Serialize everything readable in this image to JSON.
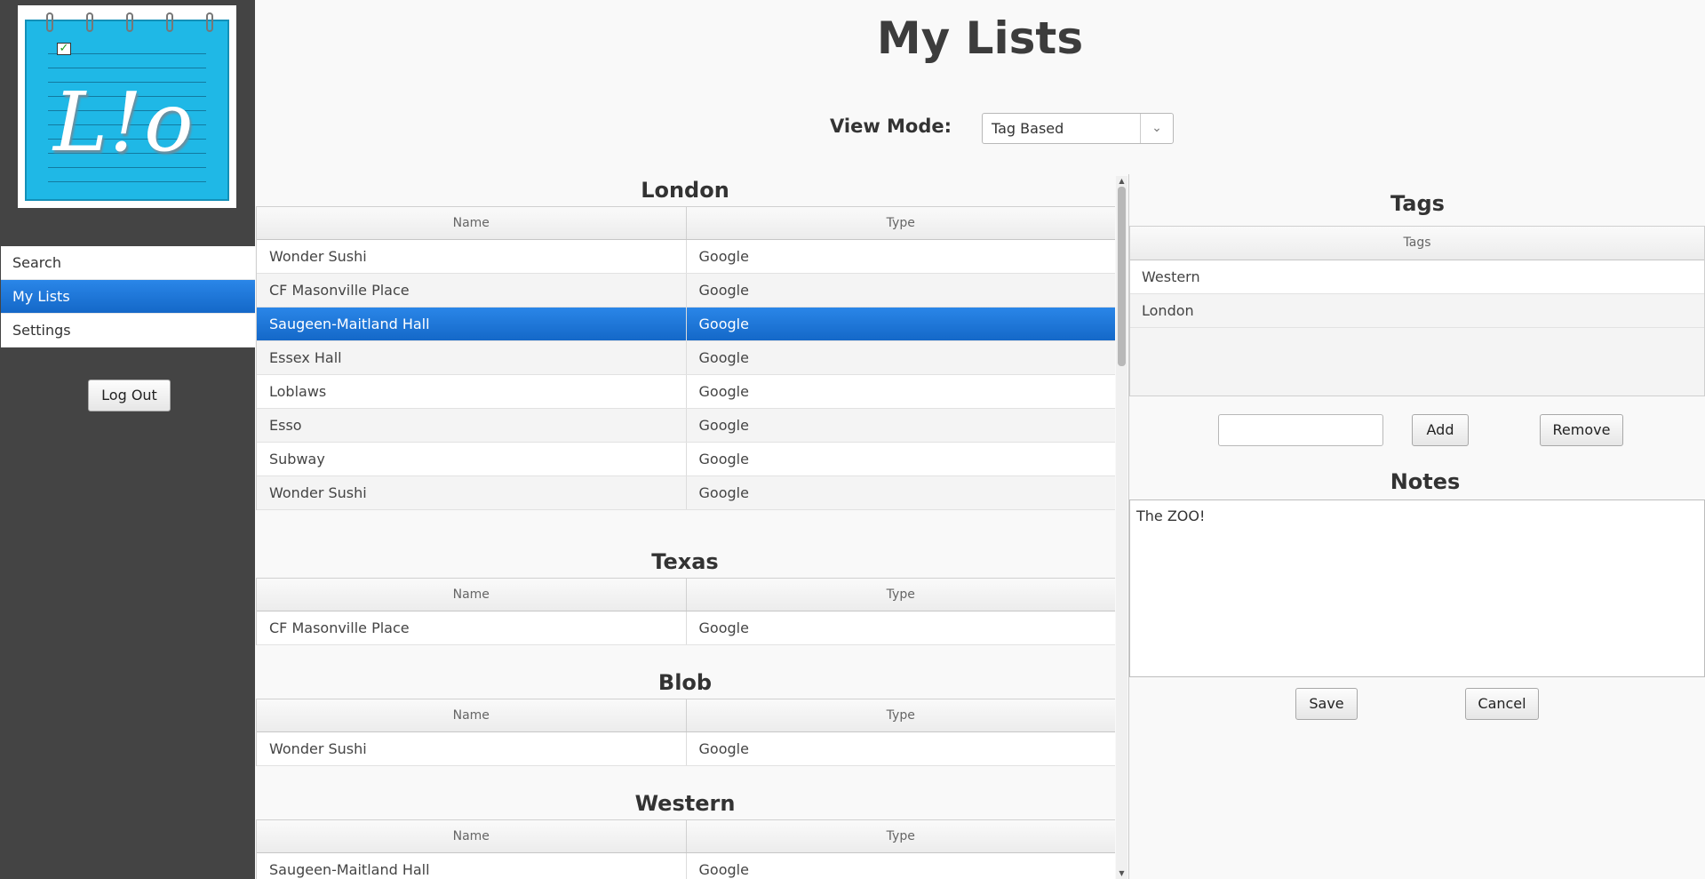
{
  "app": {
    "logo_text": "L!o"
  },
  "sidebar": {
    "items": [
      {
        "label": "Search",
        "active": false
      },
      {
        "label": "My Lists",
        "active": true
      },
      {
        "label": "Settings",
        "active": false
      }
    ],
    "logout_label": "Log Out"
  },
  "header": {
    "title": "My Lists",
    "view_mode_label": "View Mode:",
    "view_mode_value": "Tag Based"
  },
  "lists": {
    "columns": [
      "Name",
      "Type"
    ],
    "groups": [
      {
        "title": "London",
        "rows": [
          {
            "name": "Wonder Sushi",
            "type": "Google"
          },
          {
            "name": "CF Masonville Place",
            "type": "Google"
          },
          {
            "name": "Saugeen-Maitland Hall",
            "type": "Google",
            "selected": true
          },
          {
            "name": "Essex Hall",
            "type": "Google"
          },
          {
            "name": "Loblaws",
            "type": "Google"
          },
          {
            "name": "Esso",
            "type": "Google"
          },
          {
            "name": "Subway",
            "type": "Google"
          },
          {
            "name": "Wonder Sushi",
            "type": "Google"
          }
        ]
      },
      {
        "title": "Texas",
        "rows": [
          {
            "name": "CF Masonville Place",
            "type": "Google"
          }
        ]
      },
      {
        "title": "Blob",
        "rows": [
          {
            "name": "Wonder Sushi",
            "type": "Google"
          }
        ]
      },
      {
        "title": "Western",
        "rows": [
          {
            "name": "Saugeen-Maitland Hall",
            "type": "Google"
          }
        ]
      }
    ]
  },
  "tags": {
    "title": "Tags",
    "column": "Tags",
    "items": [
      "Western",
      "London"
    ],
    "input_value": "",
    "add_label": "Add",
    "remove_label": "Remove"
  },
  "notes": {
    "title": "Notes",
    "value": "The ZOO!",
    "save_label": "Save",
    "cancel_label": "Cancel"
  },
  "colors": {
    "sidebar_bg": "#444444",
    "accent": "#1a73d9",
    "logo_blue": "#1fb8e6"
  }
}
